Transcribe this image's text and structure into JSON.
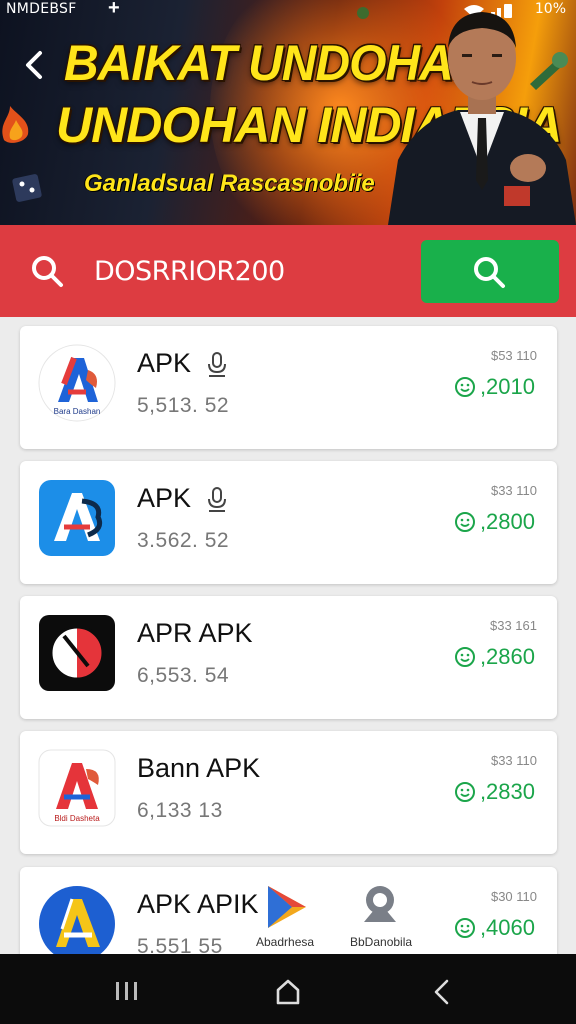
{
  "status_bar": {
    "left": "NMDEBSF",
    "plus": "+",
    "battery": "10%"
  },
  "banner": {
    "headline_1": "BAIKAT UNDOHAN",
    "headline_2": "UNDOHAN INDIAESIA",
    "subtitle": "Ganladsual Rascasnobiie"
  },
  "search": {
    "query": "DOSRRIOR200"
  },
  "apps": [
    {
      "name": "APK",
      "sub": "5,513. 52",
      "price_label": "$53 110",
      "price": ",2010",
      "icon_caption": "Bara Dashan",
      "has_mic": true
    },
    {
      "name": "APK",
      "sub": "3.562. 52",
      "price_label": "$33 110",
      "price": ",2800",
      "icon_caption": "",
      "has_mic": true
    },
    {
      "name": "APR APK",
      "sub": "6,553. 54",
      "price_label": "$33 161",
      "price": ",2860",
      "icon_caption": "",
      "has_mic": false
    },
    {
      "name": "Bann APK",
      "sub": "6,133 13",
      "price_label": "$33 110",
      "price": ",2830",
      "icon_caption": "Bldi Dasheta",
      "has_mic": false
    },
    {
      "name": "APK APIK",
      "sub": "5.551 55",
      "price_label": "$30 110",
      "price": ",4060",
      "icon_caption": "",
      "has_mic": false
    }
  ],
  "extras": {
    "item1_label": "Abadrhesa",
    "item2_label": "BbDanobila"
  },
  "colors": {
    "red": "#dd3c41",
    "green": "#19b04b",
    "price_green": "#1ba54a"
  }
}
